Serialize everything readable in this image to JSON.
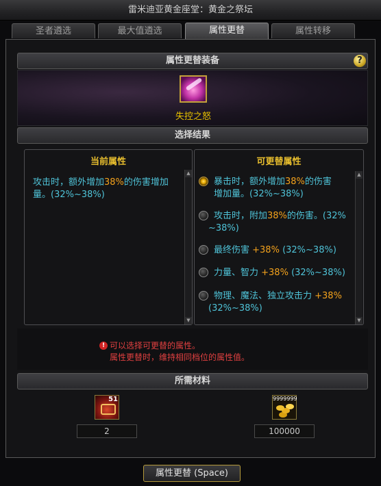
{
  "window": {
    "title": "雷米迪亚黄金座堂：黄金之祭坛"
  },
  "tabs": [
    {
      "label": "圣者遴选",
      "active": false
    },
    {
      "label": "最大值遴选",
      "active": false
    },
    {
      "label": "属性更替",
      "active": true
    },
    {
      "label": "属性转移",
      "active": false
    }
  ],
  "help_icon": {
    "glyph": "?"
  },
  "equipment": {
    "header": "属性更替装备",
    "item_name": "失控之怒",
    "icon": "pink-blade-icon"
  },
  "results": {
    "header": "选择结果",
    "current": {
      "title": "当前属性",
      "line1_pre": "攻击时，额外增加",
      "line1_pct": "38%",
      "line1_post": "的伤害增加",
      "line2": "量。(32%~38%)"
    },
    "replaceable": {
      "title": "可更替属性",
      "options": [
        {
          "selected": true,
          "pre": "暴击时，额外增加",
          "pct": "38%",
          "post": "的伤害",
          "line2": "增加量。(32%~38%)"
        },
        {
          "selected": false,
          "pre": "攻击时，附加",
          "pct": "38%",
          "post": "的伤害。(32%",
          "line2": "~38%)"
        },
        {
          "selected": false,
          "pre": "最终伤害 ",
          "pct": "+38%",
          "post": " (32%~38%)",
          "line2": ""
        },
        {
          "selected": false,
          "pre": "力量、智力 ",
          "pct": "+38%",
          "post": " (32%~38%)",
          "line2": ""
        },
        {
          "selected": false,
          "pre": "物理、魔法、独立攻击力 ",
          "pct": "+38%",
          "post": "",
          "line2": "(32%~38%)"
        }
      ]
    }
  },
  "messages": {
    "icon": "!",
    "line1": "可以选择可更替的属性。",
    "line2": "属性更替时，维持相同档位的属性值。"
  },
  "materials": {
    "header": "所需材料",
    "items": [
      {
        "icon": "red-chest-icon",
        "badge": "51",
        "count": "2"
      },
      {
        "icon": "gold-coins-icon",
        "badge": "9999999",
        "count": "100000"
      }
    ]
  },
  "action_button": {
    "label": "属性更替 (Space)"
  },
  "colors": {
    "accent_gold": "#e8be2e",
    "text_cyan": "#4fc3d8",
    "highlight_orange": "#f4a21c",
    "warning_red": "#e04040"
  }
}
